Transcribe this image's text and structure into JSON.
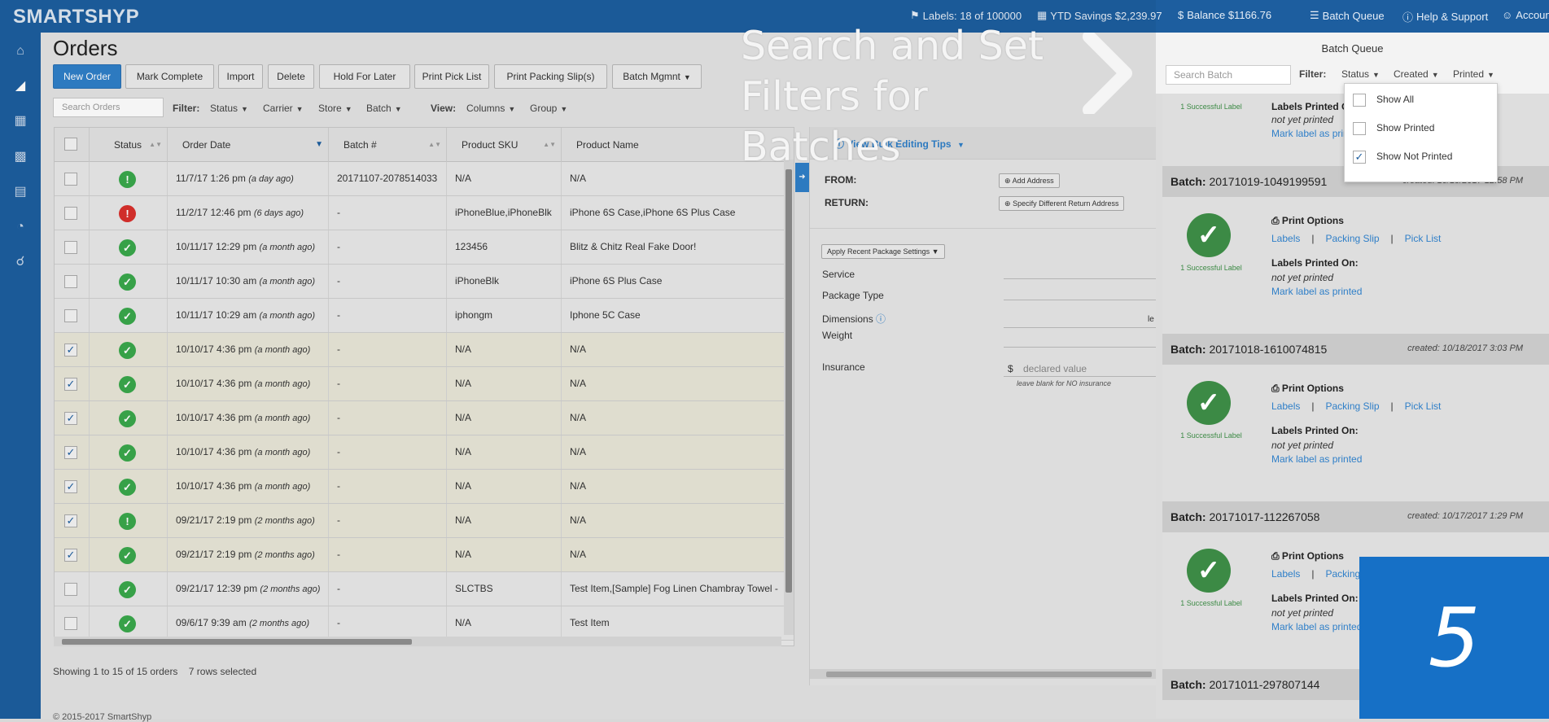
{
  "topbar": {
    "logo": "SMARTSHYP",
    "labels": "Labels: 18 of 100000",
    "ytd": "YTD Savings $2,239.97",
    "balance": "Balance $1166.76",
    "batch_queue": "Batch Queue",
    "help": "Help & Support",
    "account": "Account"
  },
  "page": {
    "title": "Orders"
  },
  "toolbar": {
    "new_order": "New Order",
    "mark_complete": "Mark Complete",
    "import": "Import",
    "delete": "Delete",
    "hold": "Hold For Later",
    "pick_list": "Print Pick List",
    "packing_slip": "Print Packing Slip(s)",
    "batch_mgmt": "Batch Mgmnt"
  },
  "filters": {
    "search_placeholder": "Search Orders",
    "filter_label": "Filter:",
    "status": "Status",
    "carrier": "Carrier",
    "store": "Store",
    "batch": "Batch",
    "view_label": "View:",
    "columns": "Columns",
    "group": "Group"
  },
  "grid": {
    "columns": [
      "Status",
      "Order Date",
      "Batch #",
      "Product SKU",
      "Product Name"
    ],
    "rows": [
      {
        "checked": false,
        "status": "warn",
        "date": "11/7/17 1:26 pm",
        "rel": "(a day ago)",
        "batch": "20171107-2078514033",
        "sku": "N/A",
        "name": "N/A"
      },
      {
        "checked": false,
        "status": "err",
        "date": "11/2/17 12:46 pm",
        "rel": "(6 days ago)",
        "batch": "-",
        "sku": "iPhoneBlue,iPhoneBlk",
        "name": "iPhone 6S Case,iPhone 6S Plus Case"
      },
      {
        "checked": false,
        "status": "ok",
        "date": "10/11/17 12:29 pm",
        "rel": "(a month ago)",
        "batch": "-",
        "sku": "123456",
        "name": "Blitz & Chitz Real Fake Door!"
      },
      {
        "checked": false,
        "status": "ok",
        "date": "10/11/17 10:30 am",
        "rel": "(a month ago)",
        "batch": "-",
        "sku": "iPhoneBlk",
        "name": "iPhone 6S Plus Case"
      },
      {
        "checked": false,
        "status": "ok",
        "date": "10/11/17 10:29 am",
        "rel": "(a month ago)",
        "batch": "-",
        "sku": "iphongm",
        "name": "Iphone 5C Case"
      },
      {
        "checked": true,
        "status": "ok",
        "date": "10/10/17 4:36 pm",
        "rel": "(a month ago)",
        "batch": "-",
        "sku": "N/A",
        "name": "N/A"
      },
      {
        "checked": true,
        "status": "ok",
        "date": "10/10/17 4:36 pm",
        "rel": "(a month ago)",
        "batch": "-",
        "sku": "N/A",
        "name": "N/A"
      },
      {
        "checked": true,
        "status": "ok",
        "date": "10/10/17 4:36 pm",
        "rel": "(a month ago)",
        "batch": "-",
        "sku": "N/A",
        "name": "N/A"
      },
      {
        "checked": true,
        "status": "ok",
        "date": "10/10/17 4:36 pm",
        "rel": "(a month ago)",
        "batch": "-",
        "sku": "N/A",
        "name": "N/A"
      },
      {
        "checked": true,
        "status": "ok",
        "date": "10/10/17 4:36 pm",
        "rel": "(a month ago)",
        "batch": "-",
        "sku": "N/A",
        "name": "N/A"
      },
      {
        "checked": true,
        "status": "warn",
        "date": "09/21/17 2:19 pm",
        "rel": "(2 months ago)",
        "batch": "-",
        "sku": "N/A",
        "name": "N/A"
      },
      {
        "checked": true,
        "status": "ok",
        "date": "09/21/17 2:19 pm",
        "rel": "(2 months ago)",
        "batch": "-",
        "sku": "N/A",
        "name": "N/A"
      },
      {
        "checked": false,
        "status": "ok",
        "date": "09/21/17 12:39 pm",
        "rel": "(2 months ago)",
        "batch": "-",
        "sku": "SLCTBS",
        "name": "Test Item,[Sample] Fog Linen Chambray Towel -"
      },
      {
        "checked": false,
        "status": "ok",
        "date": "09/6/17 9:39 am",
        "rel": "(2 months ago)",
        "batch": "-",
        "sku": "N/A",
        "name": "Test Item"
      }
    ],
    "footer": "Showing 1 to 15 of 15 orders",
    "selected": "7 rows selected"
  },
  "editor": {
    "tips": "View Bulk Editing Tips",
    "from": "FROM:",
    "return": "RETURN:",
    "add_address": "Add Address",
    "specify_return": "Specify Different Return Address",
    "recent_pkg": "Apply Recent Package Settings",
    "service": "Service",
    "package_type": "Package Type",
    "dimensions": "Dimensions",
    "weight": "Weight",
    "insurance": "Insurance",
    "dollar": "$",
    "declared_placeholder": "declared value",
    "insurance_hint": "leave blank for NO insurance",
    "dim_suffix": "le"
  },
  "copyright": "© 2015-2017 SmartShyp",
  "overlay": {
    "line1": "Search and Set",
    "line2": "Filters for Batches",
    "step": "5"
  },
  "batch_queue": {
    "title": "Batch Queue",
    "search_placeholder": "Search Batch",
    "filter_label": "Filter:",
    "status": "Status",
    "created": "Created",
    "printed": "Printed",
    "dropdown": [
      {
        "label": "Show All",
        "checked": false
      },
      {
        "label": "Show Printed",
        "checked": false
      },
      {
        "label": "Show Not Printed",
        "checked": true
      }
    ],
    "partial": {
      "success": "1 Successful Label",
      "lpo": "Labels Printed On:",
      "nyp": "not yet printed",
      "mark": "Mark label as printed"
    },
    "batches": [
      {
        "id": "20171019-1049199591",
        "created": "created: 10/19/2017 12:58 PM"
      },
      {
        "id": "20171018-1610074815",
        "created": "created: 10/18/2017 3:03 PM"
      },
      {
        "id": "20171017-112267058",
        "created": "created: 10/17/2017 1:29 PM"
      },
      {
        "id": "20171011-297807144",
        "created": ""
      }
    ],
    "batch_label": "Batch:",
    "print_options": "Print Options",
    "labels_link": "Labels",
    "slip_link": "Packing Slip",
    "pick_link": "Pick List",
    "success": "1 Successful Label",
    "lpo": "Labels Printed On:",
    "nyp": "not yet printed",
    "mark": "Mark label as printed"
  }
}
